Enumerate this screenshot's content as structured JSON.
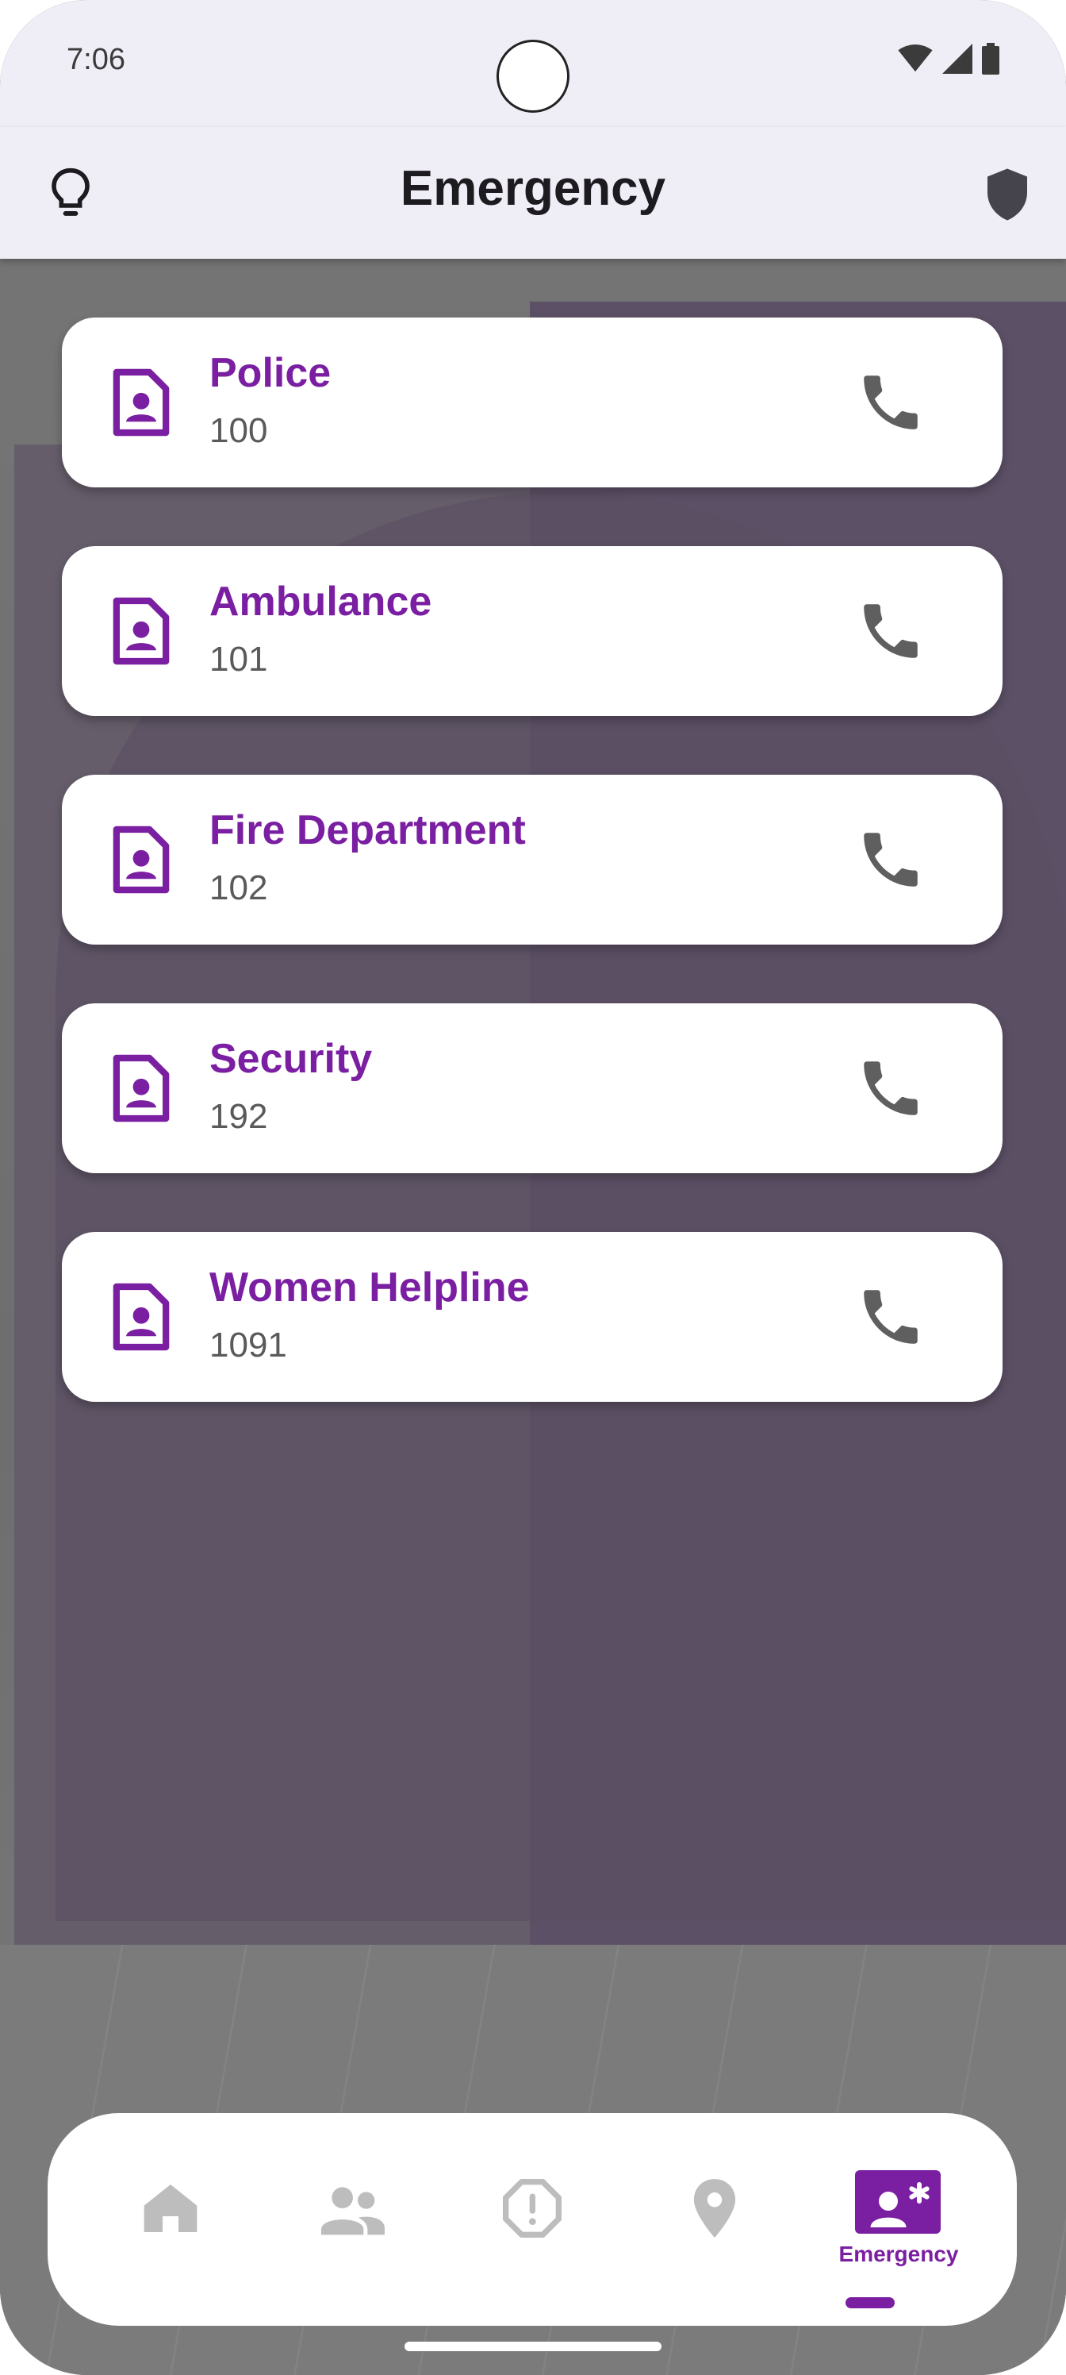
{
  "status_bar": {
    "time": "7:06"
  },
  "app_bar": {
    "title": "Emergency",
    "left_icon": "lightbulb-icon",
    "right_icon": "shield-icon"
  },
  "contacts": [
    {
      "name": "Police",
      "number": "100"
    },
    {
      "name": "Ambulance",
      "number": "101"
    },
    {
      "name": "Fire Department",
      "number": "102"
    },
    {
      "name": "Security",
      "number": "192"
    },
    {
      "name": "Women Helpline",
      "number": "1091"
    }
  ],
  "bottom_nav": {
    "items": [
      "home-icon",
      "people-icon",
      "alert-icon",
      "location-icon",
      "emergency-contact-icon"
    ],
    "active_label": "Emergency"
  },
  "colors": {
    "accent": "#7b1fa2",
    "icon_gray": "#5f5f5f",
    "inactive_nav": "#bdbdbd"
  }
}
